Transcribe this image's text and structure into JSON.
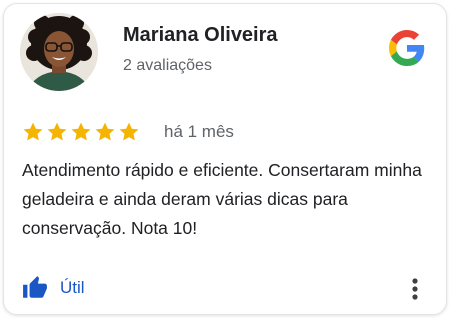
{
  "reviewer": {
    "name": "Mariana Oliveira",
    "review_count": "2 avaliações"
  },
  "brand": {
    "logo_icon": "google-g-icon"
  },
  "rating": {
    "stars": 5,
    "max_stars": 5,
    "star_color": "#f4b400"
  },
  "time_ago": "há 1 mês",
  "review_text": "Atendimento rápido e eficiente. Consertaram minha geladeira e ainda deram várias dicas para conservação. Nota 10!",
  "actions": {
    "useful_label": "Útil",
    "useful_icon": "thumbs-up-icon",
    "more_icon": "more-vert-icon",
    "accent_color": "#1a56c4"
  }
}
